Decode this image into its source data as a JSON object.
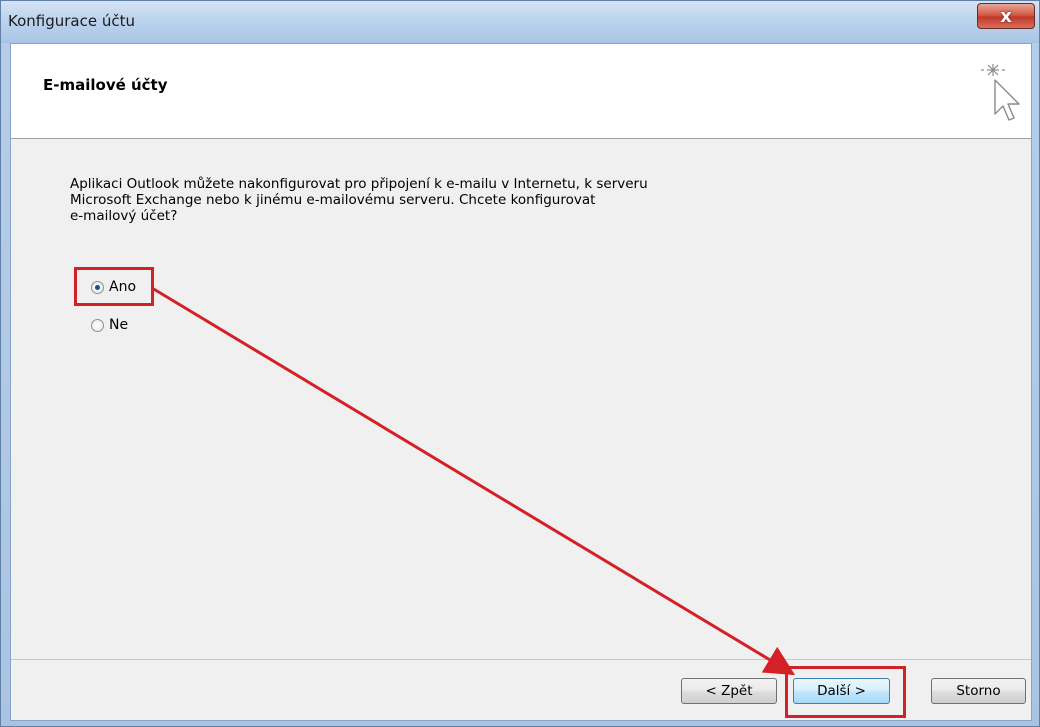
{
  "window": {
    "title": "Konfigurace účtu",
    "close_label": "x"
  },
  "header": {
    "title": "E-mailové účty",
    "icon": "wizard-cursor-icon"
  },
  "body": {
    "description_lines": [
      "Aplikaci Outlook můžete nakonfigurovat pro připojení k e-mailu v Internetu, k serveru",
      "Microsoft Exchange nebo k jinému e-mailovému serveru. Chcete konfigurovat",
      "e-mailový účet?"
    ],
    "options": [
      {
        "label": "Ano",
        "selected": true
      },
      {
        "label": "Ne",
        "selected": false
      }
    ]
  },
  "footer": {
    "back_label": "< Zpět",
    "next_label": "Další >",
    "cancel_label": "Storno"
  },
  "colors": {
    "annotation": "#d42127",
    "titlebar": "#bcd3ec",
    "close": "#c0392b",
    "default_button": "#bee6fd"
  }
}
